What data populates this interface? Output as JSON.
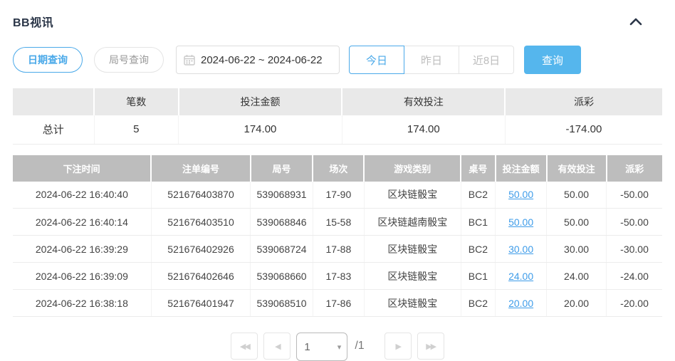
{
  "page": {
    "title": "BB视讯"
  },
  "toolbar": {
    "date_query_label": "日期查询",
    "round_query_label": "局号查询",
    "date_range_value": "2024-06-22 ~ 2024-06-22",
    "quick_filters": {
      "today": "今日",
      "yesterday": "昨日",
      "last8": "近8日"
    },
    "search_label": "查询"
  },
  "summary_table": {
    "headers": {
      "blank": "",
      "count": "笔数",
      "bet_amount": "投注金额",
      "valid_bet": "有效投注",
      "payout": "派彩"
    },
    "total_row": {
      "label": "总计",
      "count": "5",
      "bet_amount": "174.00",
      "valid_bet": "174.00",
      "payout": "-174.00"
    }
  },
  "bets_table": {
    "headers": [
      "下注时间",
      "注单编号",
      "局号",
      "场次",
      "游戏类别",
      "桌号",
      "投注金额",
      "有效投注",
      "派彩"
    ],
    "rows": [
      [
        "2024-06-22 16:40:40",
        "521676403870",
        "539068931",
        "17-90",
        "区块链骰宝",
        "BC2",
        "50.00",
        "50.00",
        "-50.00"
      ],
      [
        "2024-06-22 16:40:14",
        "521676403510",
        "539068846",
        "15-58",
        "区块链越南骰宝",
        "BC1",
        "50.00",
        "50.00",
        "-50.00"
      ],
      [
        "2024-06-22 16:39:29",
        "521676402926",
        "539068724",
        "17-88",
        "区块链骰宝",
        "BC2",
        "30.00",
        "30.00",
        "-30.00"
      ],
      [
        "2024-06-22 16:39:09",
        "521676402646",
        "539068660",
        "17-83",
        "区块链骰宝",
        "BC1",
        "24.00",
        "24.00",
        "-24.00"
      ],
      [
        "2024-06-22 16:38:18",
        "521676401947",
        "539068510",
        "17-86",
        "区块链骰宝",
        "BC2",
        "20.00",
        "20.00",
        "-20.00"
      ]
    ]
  },
  "pagination": {
    "first": "◀◀",
    "prev": "◀",
    "next": "▶",
    "last": "▶▶",
    "page_value": "1",
    "chevron": "▾",
    "total_text": "/1"
  },
  "colors": {
    "accent_blue": "#4aa9e9",
    "button_blue": "#55b6ed",
    "link_blue": "#3e9ce9",
    "negative_red": "#f25e5e",
    "summary_header_bg": "#e9e9e9",
    "table_header_bg": "#bdbdbd"
  }
}
